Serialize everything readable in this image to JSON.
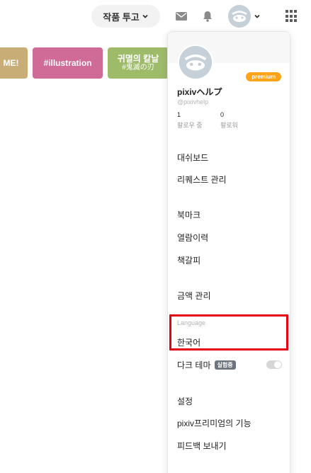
{
  "header": {
    "post_label": "작품 투고",
    "icons": [
      "mail-icon",
      "bell-icon",
      "avatar",
      "chevron-down-icon",
      "apps-grid-icon"
    ]
  },
  "tags": [
    {
      "label": "ME!",
      "sub": ""
    },
    {
      "label": "#illustration",
      "sub": ""
    },
    {
      "label": "귀멸의 칼날",
      "sub": "#鬼滅の刃"
    }
  ],
  "dropdown": {
    "premium": "premium",
    "name": "pixivヘルプ",
    "handle": "@pixivhelp",
    "following": {
      "count": "1",
      "label": "팔로우 중"
    },
    "followers": {
      "count": "0",
      "label": "팔로워"
    },
    "items": {
      "dashboard": "대쉬보드",
      "requests": "리퀘스트 관리",
      "bookmarks": "북마크",
      "history": "열람이력",
      "bookshelf": "책갈피",
      "amount": "금액 관리",
      "language_label": "Language",
      "language": "한국어",
      "dark_theme": "다크 테마",
      "dark_theme_badge": "실험중",
      "settings": "설정",
      "premium_features": "pixiv프리미엄의 기능",
      "feedback": "피드백 보내기"
    }
  },
  "colors": {
    "premium": "#ffa317",
    "highlight": "#e60012",
    "tag_1": "#c9ad76",
    "tag_2": "#cf6b96",
    "tag_3": "#9ebb6a"
  }
}
